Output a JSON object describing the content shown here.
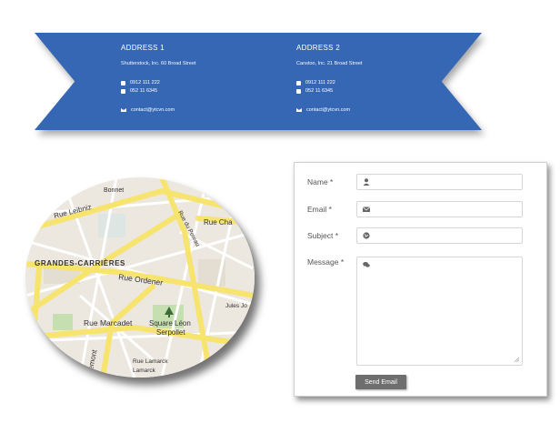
{
  "colors": {
    "ribbon": "#3567b5",
    "map_road": "#f7e46e",
    "map_land": "#ece7df",
    "button": "#6e6e6e"
  },
  "addresses": [
    {
      "title": "ADDRESS 1",
      "street": "Shutterstock, Inc. 60 Broad Street",
      "phone1": "0912 111 222",
      "phone2": "052 11 6345",
      "email": "contact@ytcvn.com"
    },
    {
      "title": "ADDRESS 2",
      "street": "Canstoo, Inc. 21 Broad Street",
      "phone1": "0912 111 222",
      "phone2": "052 11 6345",
      "email": "contact@ytcvn.com"
    }
  ],
  "map": {
    "labels": {
      "bonnet": "Bonnet",
      "leibniz": "Rue Leibniz",
      "cha": "Rue Cha",
      "poteau": "Rue du Poteau",
      "district": "GRANDES-CARRIÈRES",
      "ordener": "Rue Ordener",
      "jules": "Jules Jo",
      "marcadet": "Rue Marcadet",
      "square1": "Square Léon",
      "square2": "Serpollet",
      "lamarck1": "Rue Lamarck",
      "lamarck2": "Lamarck",
      "emont": "emont"
    },
    "icons": [
      "park-tree-icon"
    ]
  },
  "form": {
    "fields": [
      {
        "label": "Name *",
        "icon": "user-icon"
      },
      {
        "label": "Email *",
        "icon": "envelope-icon"
      },
      {
        "label": "Subject *",
        "icon": "globe-icon"
      },
      {
        "label": "Message *",
        "icon": "comments-icon"
      }
    ],
    "send_label": "Send Email"
  }
}
